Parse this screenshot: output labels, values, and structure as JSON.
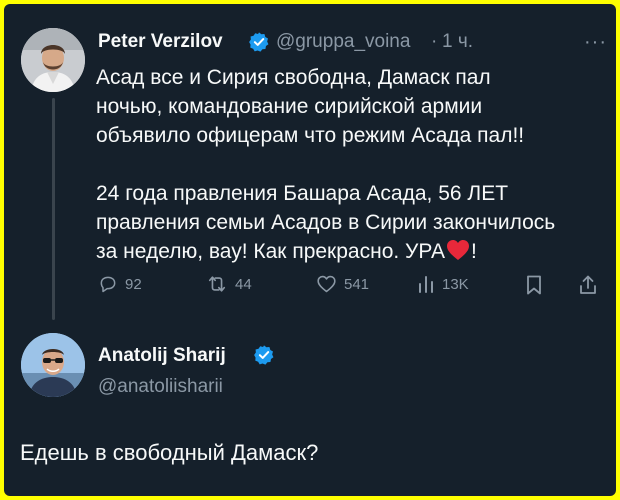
{
  "tweet": {
    "author_name": "Peter Verzilov",
    "handle": "@gruppa_voina",
    "separator": "·",
    "time": "1 ч.",
    "more_label": "···",
    "text_p1_lines": [
      "Асад все и Сирия свободна, Дамаск пал",
      "ночью, командование сирийской армии",
      "объявило офицерам что режим Асада пал!!"
    ],
    "text_p2_lines": [
      "24 года правления Башара Асада, 56 ЛЕТ",
      "правления семьи Асадов в Сирии закончилось",
      "за неделю, вау! Как прекрасно. УРА"
    ],
    "text_p2_end": "!",
    "actions": {
      "replies": "92",
      "retweets": "44",
      "likes": "541",
      "views": "13K"
    }
  },
  "reply": {
    "author_name": "Anatolij Sharij",
    "handle": "@anatoliisharii",
    "text": "Едешь в свободный Дамаск?"
  },
  "colors": {
    "background": "#15202b",
    "frame": "#ffff00",
    "text": "#f7f9f9",
    "muted": "#8b98a5",
    "verified": "#1d9bf0",
    "heart_emoji": "#e8283a"
  }
}
